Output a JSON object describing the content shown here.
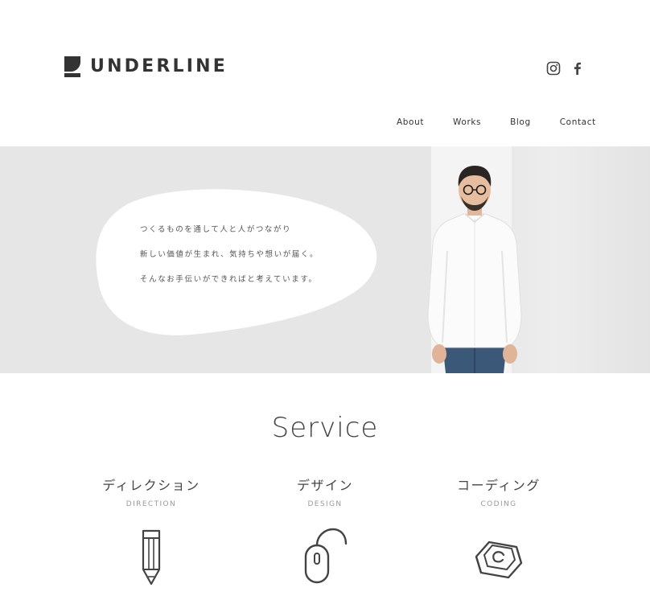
{
  "header": {
    "logo_text": "UNDERLINE",
    "social": [
      {
        "icon": "instagram-icon"
      },
      {
        "icon": "facebook-icon"
      }
    ],
    "nav": [
      "About",
      "Works",
      "Blog",
      "Contact"
    ]
  },
  "hero": {
    "lines": [
      "つくるものを通して人と人がつながり",
      "新しい価値が生まれ、気持ちや想いが届く。",
      "そんなお手伝いができればと考えています。"
    ]
  },
  "service": {
    "title": "Service",
    "items": [
      {
        "jp": "ディレクション",
        "en": "DIRECTION",
        "icon": "pencil-icon"
      },
      {
        "jp": "デザイン",
        "en": "DESIGN",
        "icon": "mouse-icon"
      },
      {
        "jp": "コーディング",
        "en": "CODING",
        "icon": "keyboard-key-icon"
      }
    ]
  },
  "colors": {
    "text": "#333333",
    "hero_bg": "#e6e6e6",
    "muted": "#999999"
  }
}
